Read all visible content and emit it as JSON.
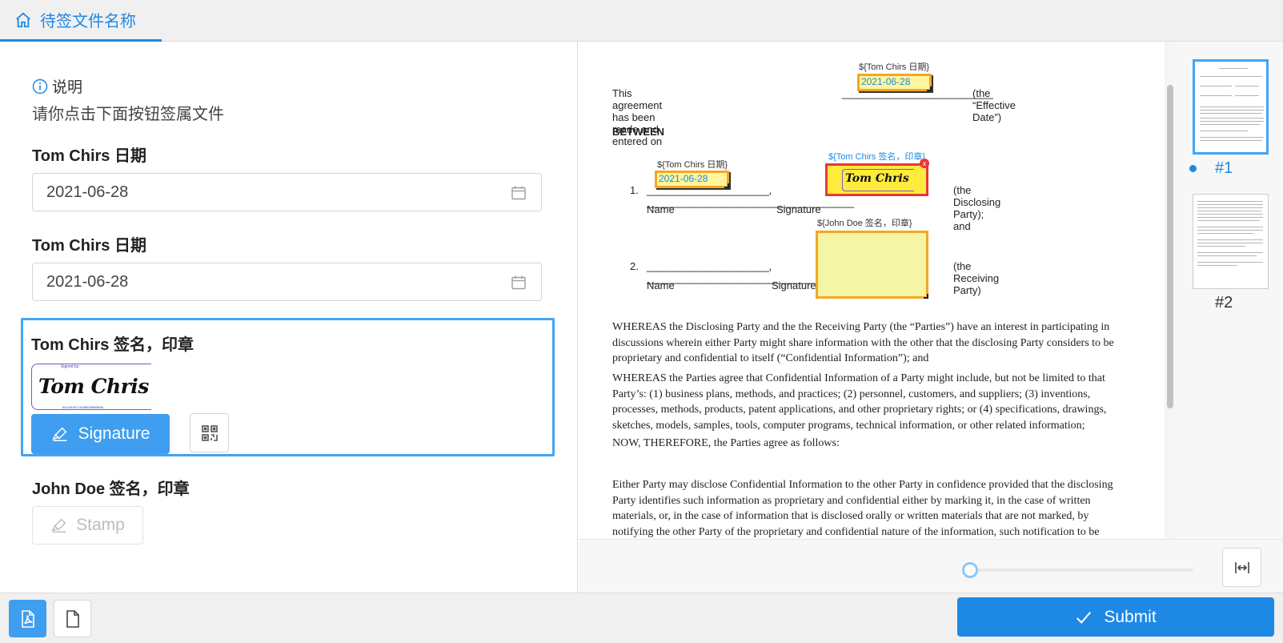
{
  "header": {
    "title": "待签文件名称",
    "home_icon": "home-icon"
  },
  "form": {
    "info_label": "说明",
    "info_text": "请你点击下面按钮签属文件",
    "fields": [
      {
        "label": "Tom Chirs 日期",
        "value": "2021-06-28"
      },
      {
        "label": "Tom Chirs 日期",
        "value": "2021-06-28"
      }
    ],
    "signature_section": {
      "label": "Tom Chirs 签名，印章",
      "preview_signed_by": "Signed by:",
      "preview_name": "Tom Chris",
      "preview_id": "6A1D6A571A2B8D6B6B6B6",
      "button_label": "Signature"
    },
    "stamp_section": {
      "label": "John Doe 签名，印章",
      "button_label": "Stamp"
    }
  },
  "bottom": {
    "submit_label": "Submit"
  },
  "document": {
    "date_tag_1": "${Tom Chirs 日期}",
    "date_value_1": "2021-06-28",
    "effective_line": "This agreement has been made and entered on",
    "effective_suffix": "(the “Effective Date”)",
    "between": "BETWEEN",
    "date_tag_2": "${Tom Chirs 日期}",
    "date_value_2": "2021-06-28",
    "sig_tag": "${Tom Chirs 签名，印章}",
    "sig_name": "Tom Chris",
    "stamp_tag": "${John Doe 签名，印章}",
    "item1_num": "1.",
    "item1_suffix": "(the Disclosing Party); and",
    "item2_num": "2.",
    "item2_suffix": "(the Receiving Party)",
    "name_label": "Name",
    "signature_label": "Signature",
    "para1": [
      "WHEREAS the Disclosing Party and the the Receiving Party (the “Parties”) have an interest in participating in",
      "discussions wherein either Party might share information with the other that the disclosing Party considers to be",
      "proprietary and confidential to itself (“Confidential Information”); and"
    ],
    "para2": [
      "WHEREAS the Parties agree that Confidential Information of a Party might include, but not be limited to that",
      "Party’s: (1) business plans, methods, and practices; (2) personnel, customers, and suppliers; (3) inventions,",
      "processes, methods, products, patent applications, and other proprietary rights; or (4) specifications, drawings,",
      "sketches, models, samples, tools, computer programs, technical information, or other related information;"
    ],
    "para3": "NOW, THEREFORE, the Parties agree as follows:",
    "para4": [
      "Either  Party may disclose Confidential Information to the other Party in confidence provided that the disclosing",
      "Party identifies such information as proprietary and confidential either by marking it, in the case of written",
      "materials, or, in the case of information that is disclosed orally or written materials that are not marked, by",
      "notifying the other Party of the proprietary and confidential nature of the information, such notification to be"
    ]
  },
  "zoom": {
    "level": 0
  },
  "thumbnails": [
    {
      "label": "#1",
      "active": true
    },
    {
      "label": "#2",
      "active": false
    }
  ],
  "colors": {
    "accent": "#1e88e5",
    "field_fill": "#fff59d",
    "field_border": "#f5a623",
    "sig_border": "#e53935"
  }
}
